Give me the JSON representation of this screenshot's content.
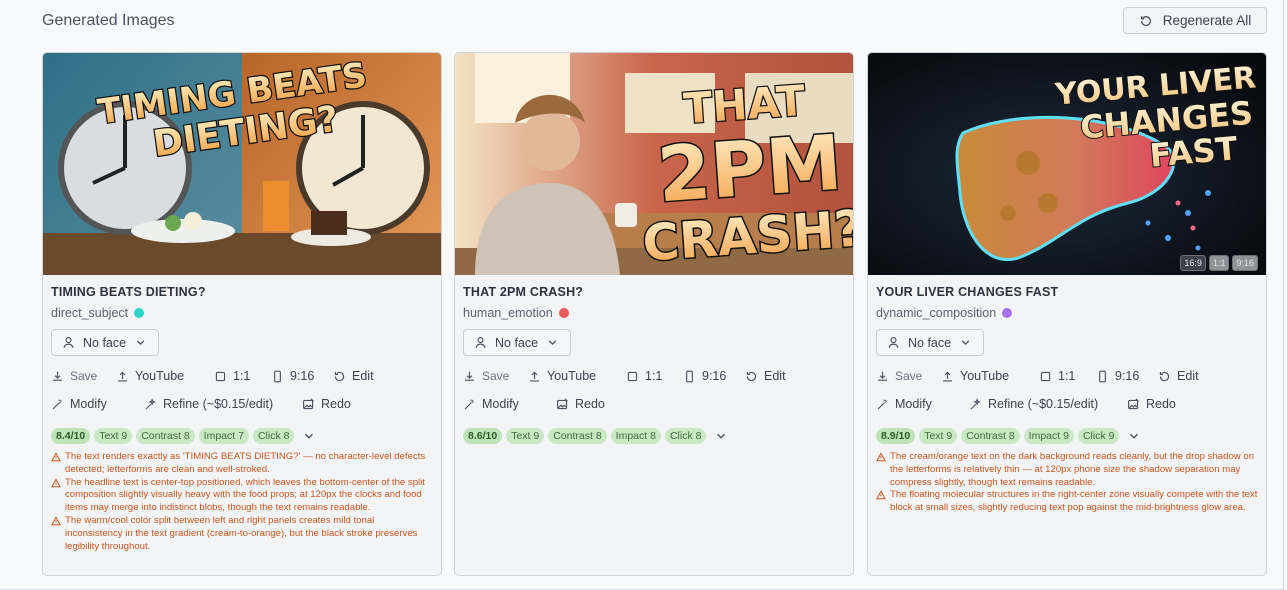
{
  "header": {
    "title": "Generated Images",
    "regenerate_label": "Regenerate All"
  },
  "cards": [
    {
      "title": "TIMING BEATS DIETING?",
      "image_text": [
        "TIMING BEATS",
        "DIETING?"
      ],
      "style": "direct_subject",
      "style_color": "#2ed3c4",
      "face": "No face",
      "actions": {
        "save": "Save",
        "youtube": "YouTube",
        "square": "1:1",
        "vertical": "9:16",
        "edit": "Edit",
        "modify": "Modify",
        "refine": "Refine (~$0.15/edit)",
        "redo": "Redo"
      },
      "score": "8.4/10",
      "chips": [
        "Text 9",
        "Contrast 8",
        "Impact 7",
        "Click 8"
      ],
      "warnings": [
        "The text renders exactly as 'TIMING BEATS DIETING?' — no character-level defects detected; letterforms are clean and well-stroked.",
        "The headline text is center-top positioned, which leaves the bottom-center of the split composition slightly visually heavy with the food props; at 120px the clocks and food items may merge into indistinct blobs, though the text remains readable.",
        "The warm/cool color split between left and right panels creates mild tonal inconsistency in the text gradient (cream-to-orange), but the black stroke preserves legibility throughout."
      ]
    },
    {
      "title": "THAT 2PM CRASH?",
      "image_text": [
        "THAT",
        "2PM",
        "CRASH?"
      ],
      "style": "human_emotion",
      "style_color": "#ee5a5a",
      "face": "No face",
      "actions": {
        "save": "Save",
        "youtube": "YouTube",
        "square": "1:1",
        "vertical": "9:16",
        "edit": "Edit",
        "modify": "Modify",
        "redo": "Redo"
      },
      "score": "8.6/10",
      "chips": [
        "Text 9",
        "Contrast 8",
        "Impact 8",
        "Click 8"
      ],
      "warnings": []
    },
    {
      "title": "YOUR LIVER CHANGES FAST",
      "image_text": [
        "YOUR LIVER",
        "CHANGES",
        "FAST"
      ],
      "style": "dynamic_composition",
      "style_color": "#a86ee8",
      "face": "No face",
      "ratios": [
        "16:9",
        "1:1",
        "9:16"
      ],
      "actions": {
        "save": "Save",
        "youtube": "YouTube",
        "square": "1:1",
        "vertical": "9:16",
        "edit": "Edit",
        "modify": "Modify",
        "refine": "Refine (~$0.15/edit)",
        "redo": "Redo"
      },
      "score": "8.9/10",
      "chips": [
        "Text 9",
        "Contrast 8",
        "Impact 9",
        "Click 9"
      ],
      "warnings": [
        "The cream/orange text on the dark background reads cleanly, but the drop shadow on the letterforms is relatively thin — at 120px phone size the shadow separation may compress slightly, though text remains readable.",
        "The floating molecular structures in the right-center zone visually compete with the text block at small sizes, slightly reducing text pop against the mid-brightness glow area."
      ]
    }
  ],
  "colors": {
    "accent_text": "#f7c56b",
    "chip_bg": "#c9e8c4",
    "warning": "#c9561e"
  }
}
